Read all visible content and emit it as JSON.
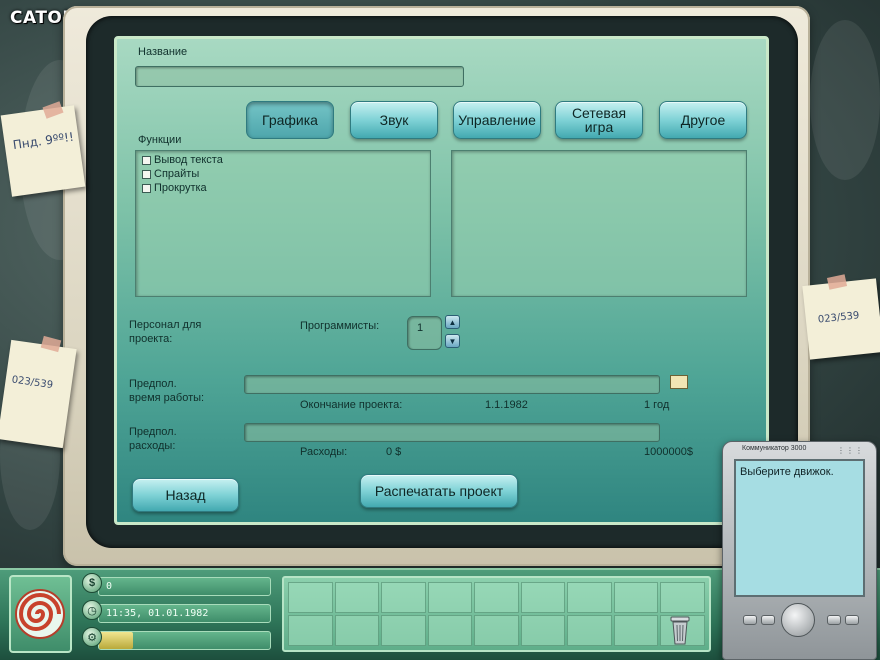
{
  "watermark": "CATORRENT.ORG",
  "form": {
    "name_label": "Название",
    "name_value": "",
    "functions_label": "Функции",
    "tabs": [
      {
        "label": "Графика",
        "active": true
      },
      {
        "label": "Звук",
        "active": false
      },
      {
        "label": "Управление",
        "active": false
      },
      {
        "label": "Сетевая игра",
        "active": false
      },
      {
        "label": "Другое",
        "active": false
      }
    ],
    "features": [
      {
        "label": "Вывод текста",
        "checked": false
      },
      {
        "label": "Спрайты",
        "checked": false
      },
      {
        "label": "Прокрутка",
        "checked": false
      }
    ],
    "staff_label": "Персонал для проекта:",
    "programmers_label": "Программисты:",
    "programmers_value": "1",
    "work_time_label": "Предпол. время работы:",
    "project_end_label": "Окончание проекта:",
    "project_end_date": "1.1.1982",
    "project_duration": "1 год",
    "costs_label": "Предпол. расходы:",
    "expenses_label": "Расходы:",
    "expenses_min": "0 $",
    "expenses_max": "1000000$",
    "back_button": "Назад",
    "print_button": "Распечатать проект"
  },
  "notes": {
    "note1": "Пнд. 9ºº!!",
    "note2": "023/539",
    "note3": "023/539"
  },
  "status": {
    "money": "0",
    "datetime": "11:35, 01.01.1982",
    "progress": 0.2
  },
  "pda": {
    "title": "Коммуникатор 3000",
    "message": "Выберите движок."
  },
  "colors": {
    "screen_top": "#a8d9c2",
    "screen_bottom": "#2f8580",
    "button": "#7fd2d6",
    "panel": "#2d7357"
  }
}
